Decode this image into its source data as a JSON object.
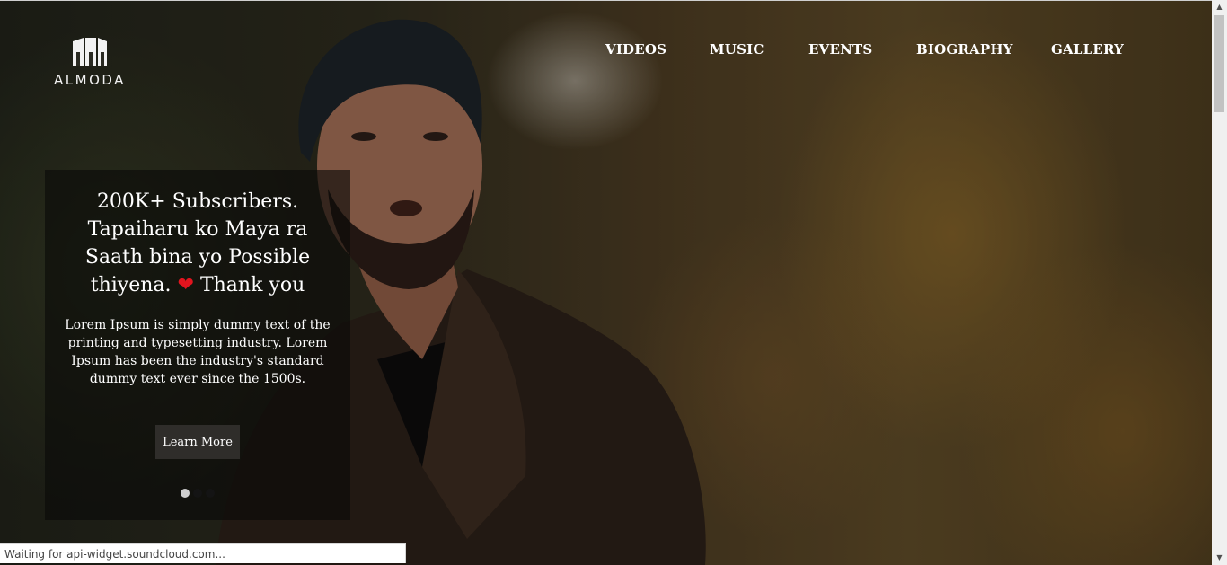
{
  "brand": {
    "name": "ALMODA"
  },
  "nav": {
    "items": [
      {
        "label": "VIDEOS"
      },
      {
        "label": "MUSIC"
      },
      {
        "label": "EVENTS"
      },
      {
        "label": "BIOGRAPHY"
      },
      {
        "label": "GALLERY"
      }
    ]
  },
  "hero": {
    "heading_text": "200K+ Subscribers. Tapaiharu ko Maya ra Saath bina yo Possible thiyena.",
    "heading_tail": "Thank you",
    "heart_icon": "heart-icon",
    "body": "Lorem Ipsum is simply dummy text of the printing and typesetting industry. Lorem Ipsum has been the industry's standard dummy text ever since the 1500s.",
    "cta_label": "Learn More",
    "carousel": {
      "slide_count": 3,
      "active_index": 0,
      "active_color": "#cfcfcf",
      "inactive_color": "#141414"
    }
  },
  "status_bar": {
    "text": "Waiting for api-widget.soundcloud.com..."
  },
  "colors": {
    "heart": "#e2141e",
    "panel_bg": "#0a0a08",
    "button_bg": "#2f2d2a"
  }
}
